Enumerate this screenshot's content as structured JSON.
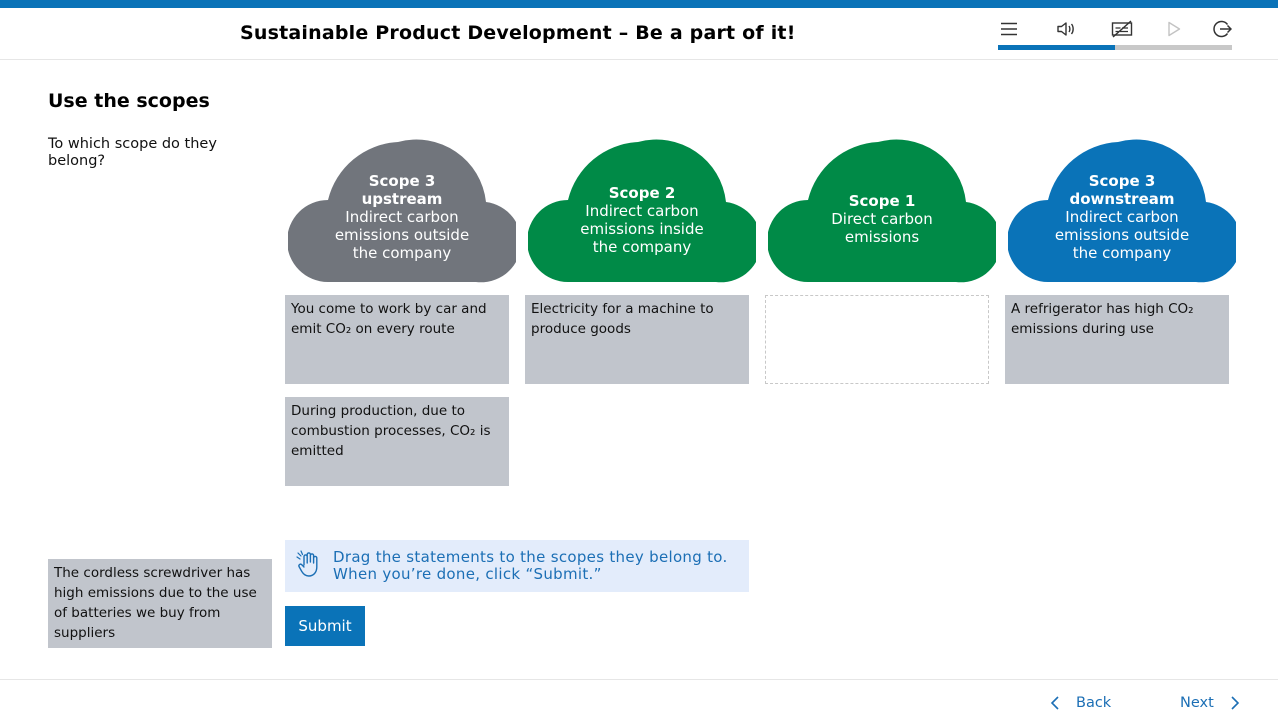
{
  "header": {
    "title": "Sustainable Product Development – Be a part of it!",
    "progress_fraction": 0.5
  },
  "toolbar": {
    "icons": [
      "menu-icon",
      "volume-icon",
      "subtitles-off-icon",
      "play-icon",
      "exit-icon"
    ]
  },
  "main": {
    "title": "Use the scopes",
    "question": "To which scope do they belong?"
  },
  "scopes": [
    {
      "title": "Scope 3 upstream",
      "desc": "Indirect carbon emissions outside the company",
      "color": "#71757c"
    },
    {
      "title": "Scope 2",
      "desc": "Indirect carbon emissions inside the company",
      "color": "#008a47"
    },
    {
      "title": "Scope 1",
      "desc": "Direct carbon emissions",
      "color": "#008a47"
    },
    {
      "title": "Scope 3 downstream",
      "desc": "Indirect carbon emissions outside the company",
      "color": "#0a73b8"
    }
  ],
  "placed_cards": {
    "scope3_up_1": "You come to work by car and emit CO₂ on every route",
    "scope3_up_2": "During production, due to combustion processes, CO₂ is emitted",
    "scope2_1": "Electricity for a machine to produce goods",
    "scope3_down_1": "A refrigerator has high CO₂ emissions during use"
  },
  "pool_card": "The cordless screwdriver has high emissions due to the use of batteries we buy from suppliers",
  "instruction": {
    "line1": "Drag the statements to the scopes they belong to.",
    "line2": "When you’re done, click “Submit.”"
  },
  "submit_label": "Submit",
  "nav": {
    "back": "Back",
    "next": "Next"
  }
}
